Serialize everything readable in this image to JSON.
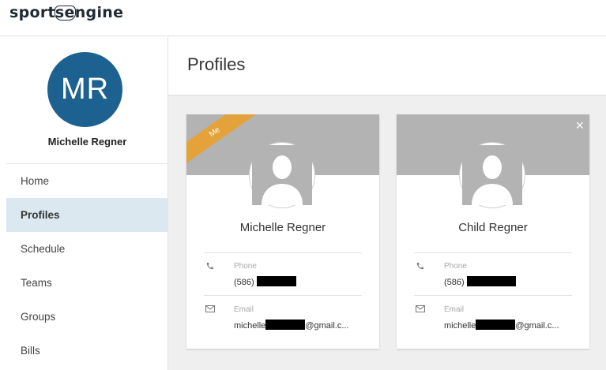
{
  "brand": {
    "logo_left": "sport",
    "logo_mid": "se",
    "logo_right": "ngine"
  },
  "sidebar": {
    "avatar_initials": "MR",
    "user_name": "Michelle Regner",
    "items": [
      {
        "label": "Home"
      },
      {
        "label": "Profiles"
      },
      {
        "label": "Schedule"
      },
      {
        "label": "Teams"
      },
      {
        "label": "Groups"
      },
      {
        "label": "Bills"
      }
    ]
  },
  "page": {
    "title": "Profiles"
  },
  "profiles": [
    {
      "badge": "Me",
      "name": "Michelle Regner",
      "phone_label": "Phone",
      "phone_prefix": "(586)",
      "email_label": "Email",
      "email_prefix": "michelle",
      "email_suffix": "@gmail.c..."
    },
    {
      "close_glyph": "×",
      "name": "Child Regner",
      "phone_label": "Phone",
      "phone_prefix": "(586)",
      "email_label": "Email",
      "email_prefix": "michelle",
      "email_suffix": "@gmail.c..."
    }
  ],
  "icons": {
    "phone": "phone-icon",
    "email": "envelope-icon",
    "close": "close-icon",
    "avatar": "person-silhouette-icon"
  },
  "colors": {
    "avatar_bg": "#1c618f",
    "ribbon": "#e4a23a",
    "active_nav": "#dbe8ef",
    "banner": "#b3b3b3"
  }
}
